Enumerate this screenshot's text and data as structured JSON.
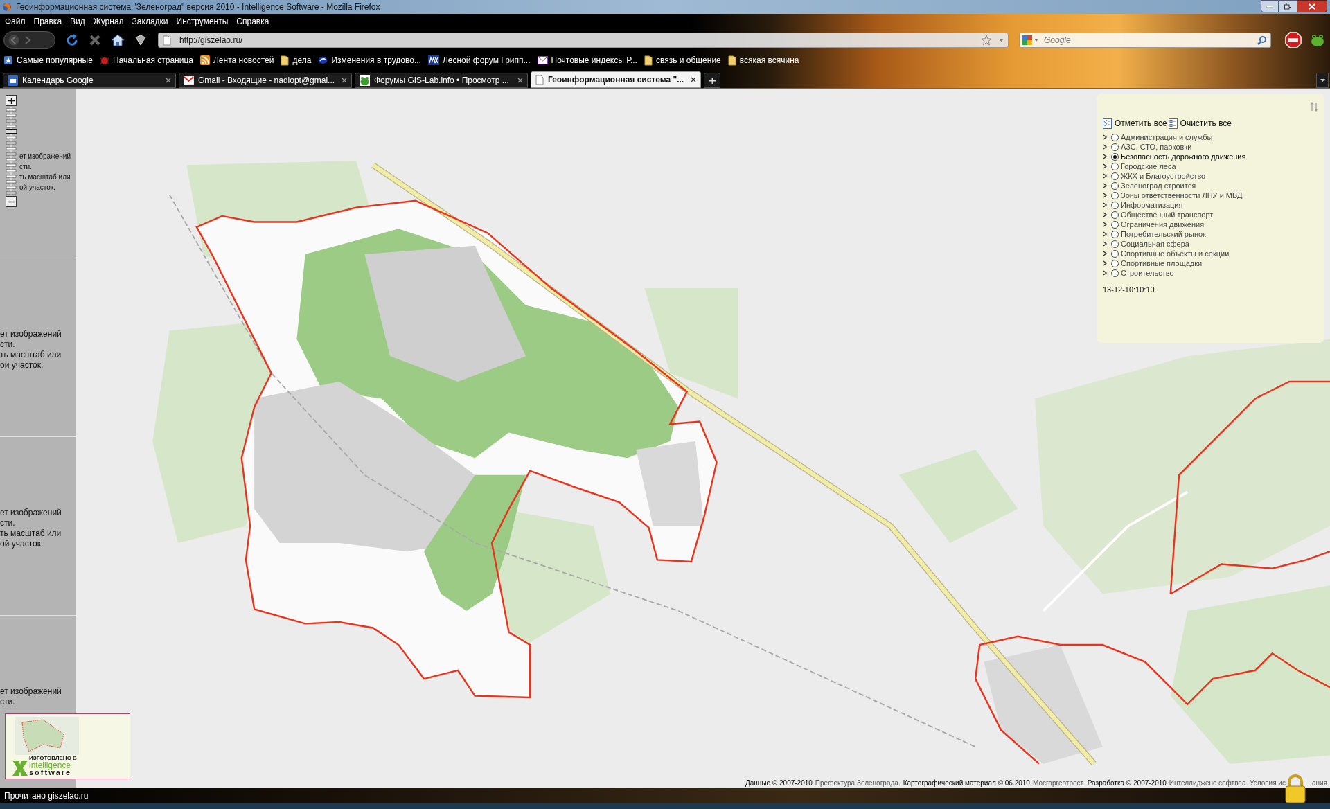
{
  "window": {
    "title": "Геоинформационная система \"Зеленоград\" версия 2010 - Intelligence Software - Mozilla Firefox"
  },
  "menu": [
    "Файл",
    "Правка",
    "Вид",
    "Журнал",
    "Закладки",
    "Инструменты",
    "Справка"
  ],
  "address": {
    "url": "http://giszelao.ru/"
  },
  "search": {
    "placeholder": "Google"
  },
  "bookmarks": [
    {
      "label": "Самые популярные",
      "kind": "popular"
    },
    {
      "label": "Начальная страница",
      "kind": "bug"
    },
    {
      "label": "Лента новостей",
      "kind": "feed"
    },
    {
      "label": "дела",
      "kind": "folder"
    },
    {
      "label": "Изменения в трудово...",
      "kind": "swirl"
    },
    {
      "label": "Лесной форум Грипп...",
      "kind": "mx"
    },
    {
      "label": "Почтовые индексы Р...",
      "kind": "mail"
    },
    {
      "label": "связь и общение",
      "kind": "folder"
    },
    {
      "label": "всякая всячина",
      "kind": "folder"
    }
  ],
  "tabs": [
    {
      "label": "Календарь Google",
      "kind": "calendar",
      "selected": false
    },
    {
      "label": "Gmail - Входящие - nadiopt@gmai...",
      "kind": "gmail",
      "selected": false
    },
    {
      "label": "Форумы GIS-Lab.info • Просмотр ...",
      "kind": "frog",
      "selected": false
    },
    {
      "label": "Геоинформационная система \"...",
      "kind": "page",
      "selected": true
    }
  ],
  "tile_messages": [
    {
      "lines": [
        "ет изображений",
        "сти.",
        "ть масштаб или",
        "ой участок."
      ]
    },
    {
      "lines": [
        "ет изображений",
        "сти.",
        "ть масштаб или",
        "ой участок."
      ]
    },
    {
      "lines": [
        "ет изображений",
        "сти.",
        "ть масштаб или",
        "ой участок."
      ]
    },
    {
      "lines": [
        "ет изображений",
        "сти."
      ]
    }
  ],
  "zoom": {
    "level": 0.75
  },
  "legend": {
    "check_all": "Отметить все",
    "clear_all": "Очистить все",
    "layers": [
      {
        "label": "Администрация и службы",
        "selected": false
      },
      {
        "label": "АЗС, СТО, парковки",
        "selected": false
      },
      {
        "label": "Безопасность дорожного движения",
        "selected": true
      },
      {
        "label": "Городские леса",
        "selected": false
      },
      {
        "label": "ЖКХ и Благоустройство",
        "selected": false
      },
      {
        "label": "Зеленоград строится",
        "selected": false
      },
      {
        "label": "Зоны ответственности ЛПУ и МВД",
        "selected": false
      },
      {
        "label": "Информатизация",
        "selected": false
      },
      {
        "label": "Общественный транспорт",
        "selected": false
      },
      {
        "label": "Ограничения движения",
        "selected": false
      },
      {
        "label": "Потребительский рынок",
        "selected": false
      },
      {
        "label": "Социальная сфера",
        "selected": false
      },
      {
        "label": "Спортивные объекты и секции",
        "selected": false
      },
      {
        "label": "Спортивные площадки",
        "selected": false
      },
      {
        "label": "Строительство",
        "selected": false
      }
    ],
    "timestamp": "13-12-10:10:10"
  },
  "overview": {
    "logo_lines": [
      "ИЗГОТОВЛЕНО В",
      "intelligence",
      "software"
    ]
  },
  "attribution": [
    {
      "text": "Данные © 2007-2010",
      "link": false
    },
    {
      "text": "Префектура Зеленограда.",
      "link": true
    },
    {
      "text": "Картографический материал © 06.2010",
      "link": false
    },
    {
      "text": "Мосгоргеотрест.",
      "link": true
    },
    {
      "text": "Разработка © 2007-2010",
      "link": false
    },
    {
      "text": "Интеллидженс софтвеа. Условия ис",
      "link": true
    },
    {
      "text": "ания",
      "link": true
    }
  ],
  "status_bar": "Прочитано giszelao.ru"
}
